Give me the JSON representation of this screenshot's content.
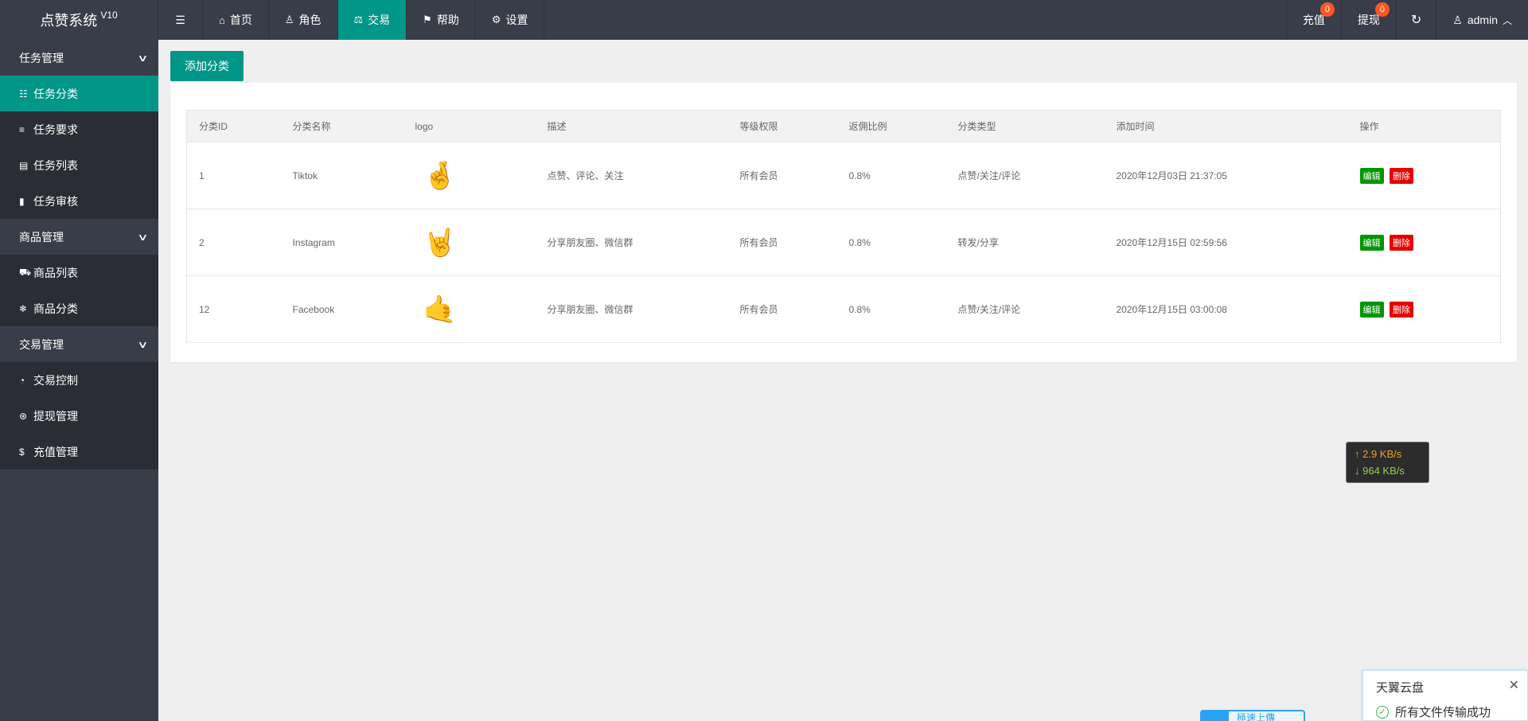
{
  "header": {
    "app_name": "点赞系统",
    "version": "V10",
    "menu_toggle_icon": "menu-toggle-icon",
    "nav": [
      {
        "label": "首页",
        "icon": "home-icon",
        "active": false
      },
      {
        "label": "角色",
        "icon": "user-icon",
        "active": false
      },
      {
        "label": "交易",
        "icon": "scale-icon",
        "active": true
      },
      {
        "label": "帮助",
        "icon": "flag-icon",
        "active": false
      },
      {
        "label": "设置",
        "icon": "gear-icon",
        "active": false
      }
    ],
    "right": {
      "recharge_label": "充值",
      "recharge_badge": "0",
      "withdraw_label": "提现",
      "withdraw_badge": "0",
      "refresh_icon": "refresh-icon",
      "user_label": "admin"
    }
  },
  "sidebar": {
    "groups": [
      {
        "label": "任务管理",
        "items": [
          {
            "label": "任务分类",
            "icon": "list-icon",
            "active": true
          },
          {
            "label": "任务要求",
            "icon": "bars-icon",
            "active": false
          },
          {
            "label": "任务列表",
            "icon": "table-icon",
            "active": false
          },
          {
            "label": "任务审核",
            "icon": "bookmark-icon",
            "active": false
          }
        ]
      },
      {
        "label": "商品管理",
        "items": [
          {
            "label": "商品列表",
            "icon": "cart-icon",
            "active": false
          },
          {
            "label": "商品分类",
            "icon": "snowflake-icon",
            "active": false
          }
        ]
      },
      {
        "label": "交易管理",
        "items": [
          {
            "label": "交易控制",
            "icon": "dashboard-icon",
            "active": false
          },
          {
            "label": "提现管理",
            "icon": "dollar-circle-icon",
            "active": false
          },
          {
            "label": "充值管理",
            "icon": "dollar-icon",
            "active": false
          }
        ]
      }
    ]
  },
  "main": {
    "add_button_label": "添加分类",
    "table": {
      "columns": [
        "分类ID",
        "分类名称",
        "logo",
        "描述",
        "等级权限",
        "返佣比例",
        "分类类型",
        "添加时间",
        "操作"
      ],
      "rows": [
        {
          "id": "1",
          "name": "Tiktok",
          "logo": "🤞",
          "desc": "点赞、评论、关注",
          "level": "所有会员",
          "ratio": "0.8%",
          "type": "点赞/关注/评论",
          "time": "2020年12月03日 21:37:05"
        },
        {
          "id": "2",
          "name": "Instagram",
          "logo": "🤘",
          "desc": "分享朋友圈、微信群",
          "level": "所有会员",
          "ratio": "0.8%",
          "type": "转发/分享",
          "time": "2020年12月15日 02:59:56"
        },
        {
          "id": "12",
          "name": "Facebook",
          "logo": "🤙",
          "desc": "分享朋友圈、微信群",
          "level": "所有会员",
          "ratio": "0.8%",
          "type": "点赞/关注/评论",
          "time": "2020年12月15日 03:00:08"
        }
      ],
      "edit_label": "编辑",
      "delete_label": "删除"
    }
  },
  "overlays": {
    "speed_up": "2.9 KB/s",
    "speed_down": "964 KB/s",
    "upload_text": "極速上傳",
    "toast_title": "天翼云盘",
    "toast_message": "所有文件传输成功"
  }
}
